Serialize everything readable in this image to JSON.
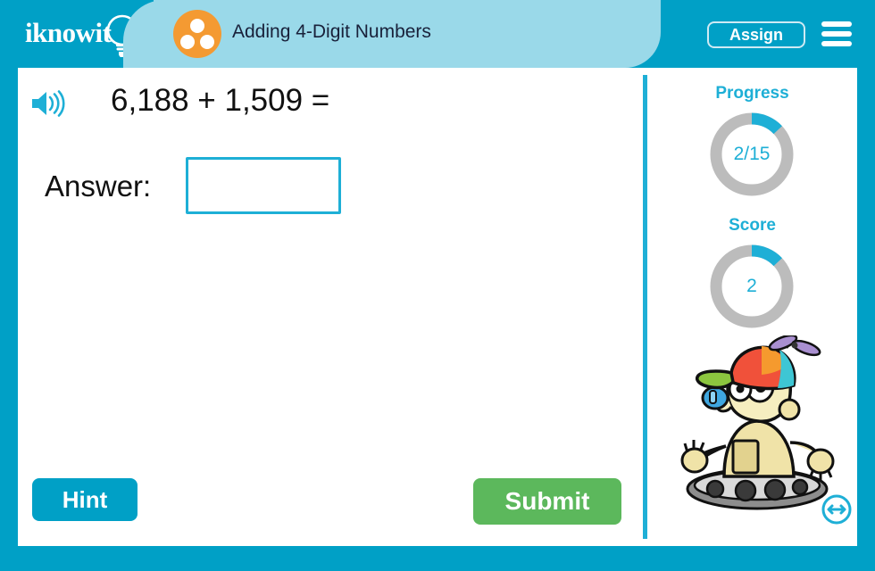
{
  "header": {
    "logo_text": "iknowit",
    "logo_icon": "lightbulb-icon",
    "tab_icon": "three-dots-circle-icon",
    "tab_title": "Adding 4-Digit Numbers",
    "assign_label": "Assign",
    "menu_icon": "hamburger-menu-icon",
    "colors": {
      "brand_blue": "#00a0c6",
      "tab_light_blue": "#9ad9e9",
      "title_text": "#19213a"
    }
  },
  "question": {
    "speaker_icon": "speaker-audio-icon",
    "text": "6,188 + 1,509 =",
    "answer_label": "Answer:",
    "answer_value": "",
    "answer_placeholder": ""
  },
  "actions": {
    "hint_label": "Hint",
    "submit_label": "Submit",
    "hint_color": "#00a0c6",
    "submit_color": "#5cb85c"
  },
  "sidebar": {
    "progress": {
      "label": "Progress",
      "value": "2/15",
      "completed": 2,
      "total": 15,
      "percent": 13
    },
    "score": {
      "label": "Score",
      "value": "2",
      "percent": 13
    },
    "mascot_icon": "robot-mascot-propeller-hat",
    "resize_icon": "horizontal-resize-arrows-icon",
    "ring_colors": {
      "track": "#bcbcbc",
      "fill": "#1eafd6",
      "text": "#1eafd6"
    }
  }
}
